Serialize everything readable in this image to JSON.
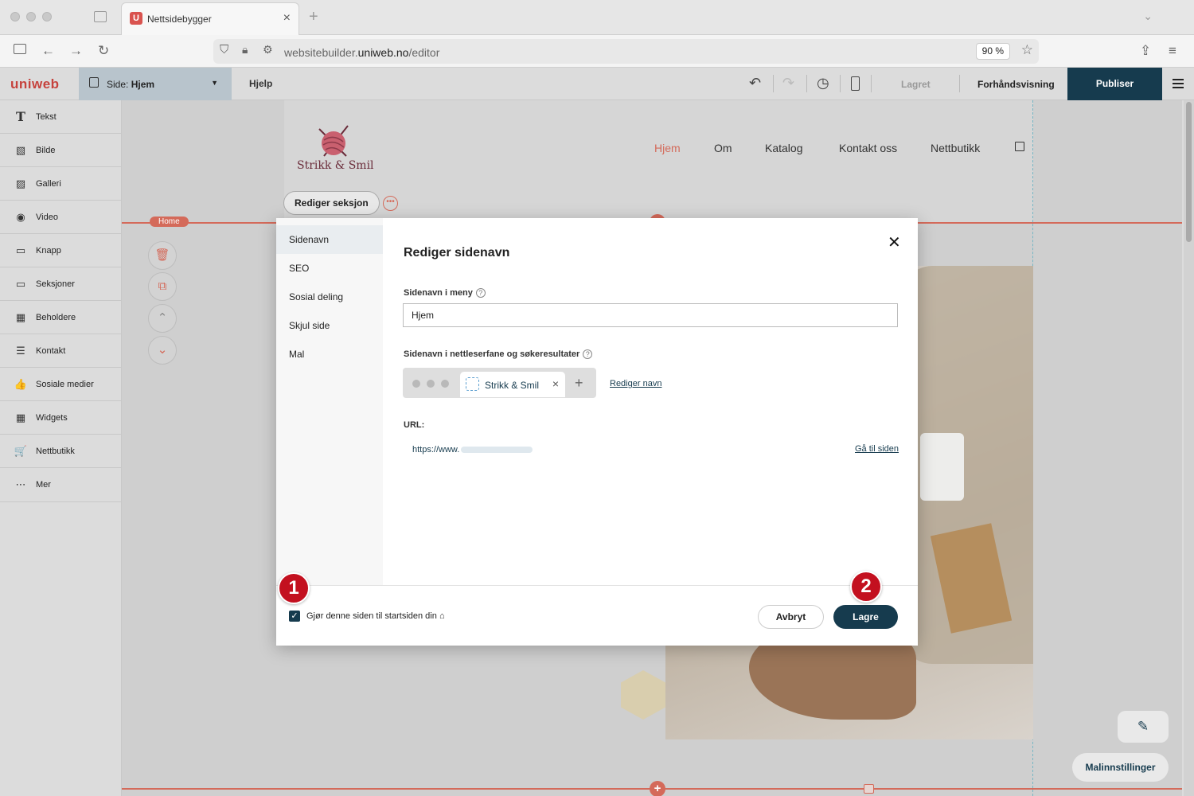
{
  "browser": {
    "tab_title": "Nettsidebygger",
    "tab_favicon": "U",
    "url_prefix": "websitebuilder.",
    "url_domain": "uniweb.no",
    "url_suffix": "/editor",
    "zoom": "90 %"
  },
  "toolbar": {
    "logo": "uniweb",
    "page_prefix": "Side: ",
    "page_name": "Hjem",
    "help": "Hjelp",
    "saved": "Lagret",
    "preview": "Forhåndsvisning",
    "publish": "Publiser"
  },
  "sidebar": {
    "items": [
      {
        "label": "Tekst",
        "icon": "T"
      },
      {
        "label": "Bilde",
        "icon": "▧"
      },
      {
        "label": "Galleri",
        "icon": "▨"
      },
      {
        "label": "Video",
        "icon": "◉"
      },
      {
        "label": "Knapp",
        "icon": "▭"
      },
      {
        "label": "Seksjoner",
        "icon": "▭"
      },
      {
        "label": "Beholdere",
        "icon": "▦"
      },
      {
        "label": "Kontakt",
        "icon": "☰"
      },
      {
        "label": "Sosiale medier",
        "icon": "👍"
      },
      {
        "label": "Widgets",
        "icon": "▦"
      },
      {
        "label": "Nettbutikk",
        "icon": "🛒"
      },
      {
        "label": "Mer",
        "icon": "⋯"
      }
    ]
  },
  "site": {
    "brand": "Strikk & Smil",
    "nav": [
      "Hjem",
      "Om",
      "Katalog",
      "Kontakt oss",
      "Nettbutikk"
    ],
    "edit_section": "Rediger seksjon",
    "home_tag": "Home",
    "template_settings": "Malinnstillinger"
  },
  "modal": {
    "nav": [
      "Sidenavn",
      "SEO",
      "Sosial deling",
      "Skjul side",
      "Mal"
    ],
    "title": "Rediger sidenavn",
    "menu_name_label": "Sidenavn i meny",
    "menu_name_value": "Hjem",
    "tab_name_label": "Sidenavn i nettleserfane og søkeresultater",
    "tab_name_value": "Strikk & Smil",
    "edit_name_link": "Rediger navn",
    "url_label": "URL:",
    "url_value": "https://www.",
    "go_to_page": "Gå til siden",
    "make_homepage_label": "Gjør denne siden til startsiden din",
    "cancel": "Avbryt",
    "save": "Lagre"
  },
  "annotations": [
    "1",
    "2"
  ],
  "colors": {
    "accent": "#163b4e",
    "brand_red": "#c6423c",
    "section_line": "#d46a5a",
    "badge": "#c3101f"
  }
}
